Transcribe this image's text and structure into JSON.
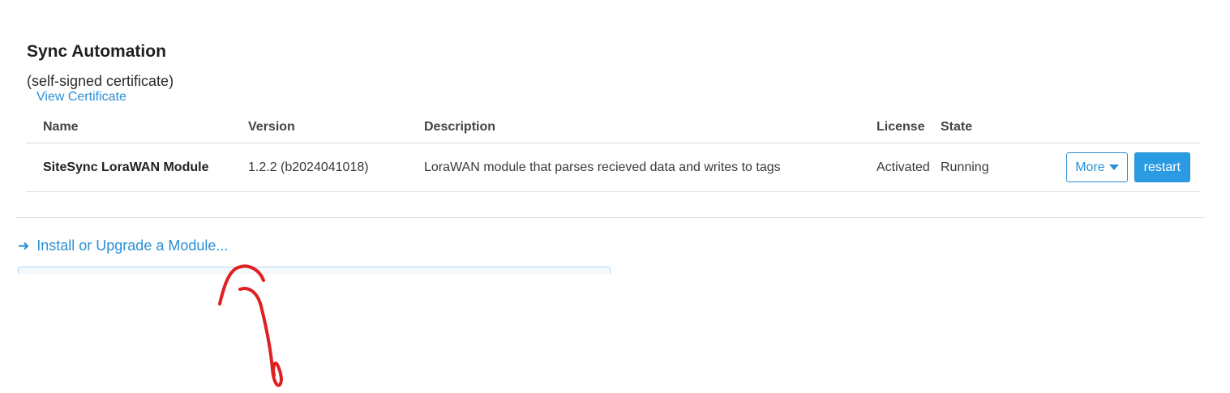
{
  "vendor": {
    "name": "Sync Automation",
    "certificate_note": "(self-signed certificate)",
    "view_certificate_label": "View Certificate"
  },
  "table": {
    "headers": {
      "name": "Name",
      "version": "Version",
      "description": "Description",
      "license": "License",
      "state": "State"
    },
    "rows": [
      {
        "name": "SiteSync LoraWAN Module",
        "version": "1.2.2 (b2024041018)",
        "description": "LoraWAN module that parses recieved data and writes to tags",
        "license": "Activated",
        "state": "Running",
        "more_label": "More",
        "restart_label": "restart"
      }
    ]
  },
  "install": {
    "label": "Install or Upgrade a Module..."
  },
  "icons": {
    "install_arrow": "arrow-right-icon",
    "more_caret": "caret-down-icon"
  },
  "colors": {
    "accent": "#2a8fd6",
    "restart_bg": "#2a9be2",
    "annotation": "#e0201f"
  }
}
